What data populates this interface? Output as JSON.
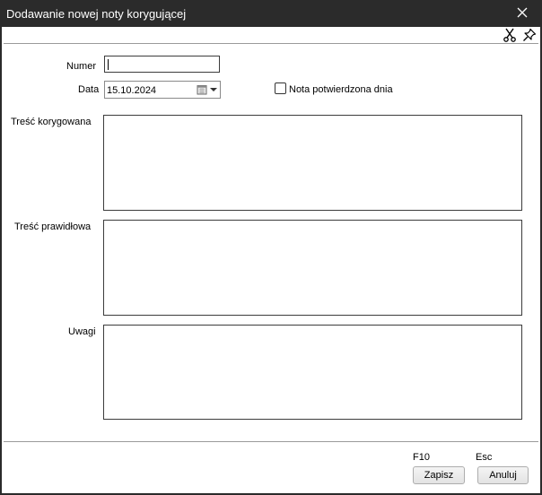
{
  "window": {
    "title": "Dodawanie nowej noty korygującej"
  },
  "toolbar": {
    "icons": [
      "scissors-icon",
      "pin-icon"
    ]
  },
  "form": {
    "numer_label": "Numer",
    "numer_value": "",
    "data_label": "Data",
    "data_value": "15.10.2024",
    "nota_checkbox_label": "Nota potwierdzona dnia",
    "nota_checked": false,
    "tresc_korygowana_label": "Treść korygowana",
    "tresc_korygowana_value": "",
    "tresc_prawidlowa_label": "Treść prawidłowa",
    "tresc_prawidlowa_value": "",
    "uwagi_label": "Uwagi",
    "uwagi_value": ""
  },
  "footer": {
    "save_key": "F10",
    "save_label": "Zapisz",
    "cancel_key": "Esc",
    "cancel_label": "Anuluj"
  },
  "colors": {
    "titlebar_bg": "#2b2b2b",
    "client_bg": "#ffffff",
    "border": "#3c3c3c"
  }
}
